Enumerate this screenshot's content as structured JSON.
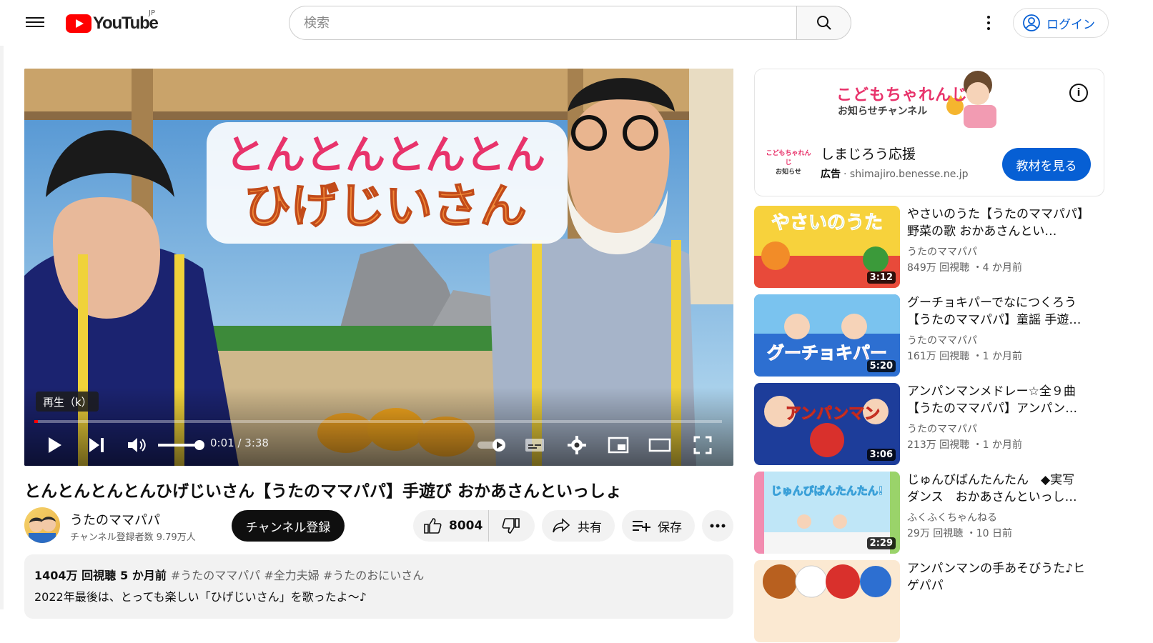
{
  "header": {
    "logo_text": "YouTube",
    "country_code": "JP",
    "search_placeholder": "検索",
    "login_label": "ログイン"
  },
  "player": {
    "tooltip": "再生（k）",
    "time": "0:01 / 3:38",
    "progress": 0.005,
    "volume": 1.0,
    "thumbnail_title_line1": "とんとんとんとん",
    "thumbnail_title_line2": "ひげじいさん"
  },
  "video": {
    "title": "とんとんとんとんひげじいさん【うたのママパパ】手遊び おかあさんといっしょ",
    "channel": "うたのママパパ",
    "subscribers": "チャンネル登録者数 9.79万人",
    "subscribe_label": "チャンネル登録",
    "likes": "8004",
    "share_label": "共有",
    "save_label": "保存",
    "views": "1404万 回視聴",
    "age": "5 か月前",
    "tags": "#うたのママパパ #全力夫婦 #うたのおにいさん",
    "description_line": "2022年最後は、とっても楽しい「ひげじいさん」を歌ったよ〜♪"
  },
  "ad": {
    "brand": "こどもちゃれんじ",
    "brand_sub": "お知らせチャンネル",
    "logo_line1": "こどもちゃれんじ",
    "logo_line2": "お知らせ",
    "title": "しまじろう応援",
    "label": "広告",
    "domain": "shimajiro.benesse.ne.jp",
    "cta": "教材を見る"
  },
  "recommendations": [
    {
      "title": "やさいのうた【うたのママパパ】野菜の歌 おかあさんとい…",
      "channel": "うたのママパパ",
      "meta": "849万 回視聴 ・4 か月前",
      "duration": "3:12",
      "thumb_text": "やさいのうた"
    },
    {
      "title": "グーチョキパーでなにつくろう【うたのママパパ】童謡 手遊…",
      "channel": "うたのママパパ",
      "meta": "161万 回視聴 ・1 か月前",
      "duration": "5:20",
      "thumb_text": "グーチョキパー"
    },
    {
      "title": "アンパンマンメドレー☆全９曲【うたのママパパ】アンパン…",
      "channel": "うたのママパパ",
      "meta": "213万 回視聴 ・1 か月前",
      "duration": "3:06",
      "thumb_text": "アンパンマン"
    },
    {
      "title": "じゅんびばんたんたん　◆実写ダンス　おかあさんといっし…",
      "channel": "ふくふくちゃんねる",
      "meta": "29万 回視聴 ・10 日前",
      "duration": "2:29",
      "thumb_text": "じゅんびばんたんたん!"
    },
    {
      "title": "アンパンマンの手あそびうた♪ヒゲパパ",
      "channel": "",
      "meta": "",
      "duration": "",
      "thumb_text": ""
    }
  ]
}
